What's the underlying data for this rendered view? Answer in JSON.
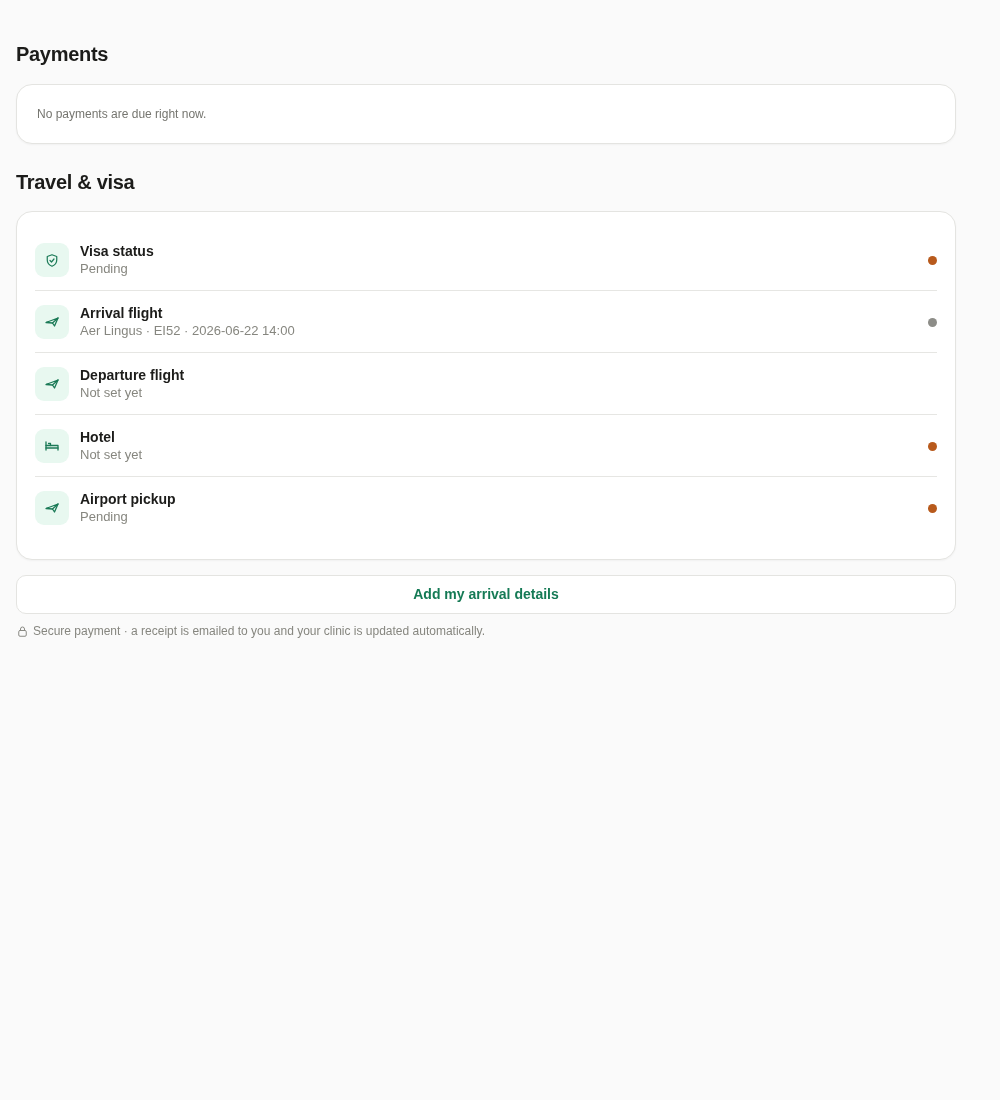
{
  "payments": {
    "title": "Payments",
    "message": "No payments are due right now."
  },
  "travel": {
    "title": "Travel & visa",
    "items": [
      {
        "kind": "shield",
        "title": "Visa status",
        "detail": "Pending",
        "color": "#b85a1c"
      },
      {
        "kind": "plane",
        "title": "Arrival flight",
        "detail": "Aer Lingus · EI52 · 2026-06-22 14:00",
        "color": "#8d8d88"
      },
      {
        "kind": "plane",
        "title": "Departure flight",
        "detail": "Not set yet"
      },
      {
        "kind": "bed",
        "title": "Hotel",
        "detail": "Not set yet",
        "color": "#b85a1c"
      },
      {
        "kind": "plane",
        "title": "Airport pickup",
        "detail": "Pending",
        "color": "#b85a1c"
      }
    ]
  },
  "action_button": "Add my arrival details",
  "footer_note": "Secure payment · a receipt is emailed to you and your clinic is updated automatically."
}
